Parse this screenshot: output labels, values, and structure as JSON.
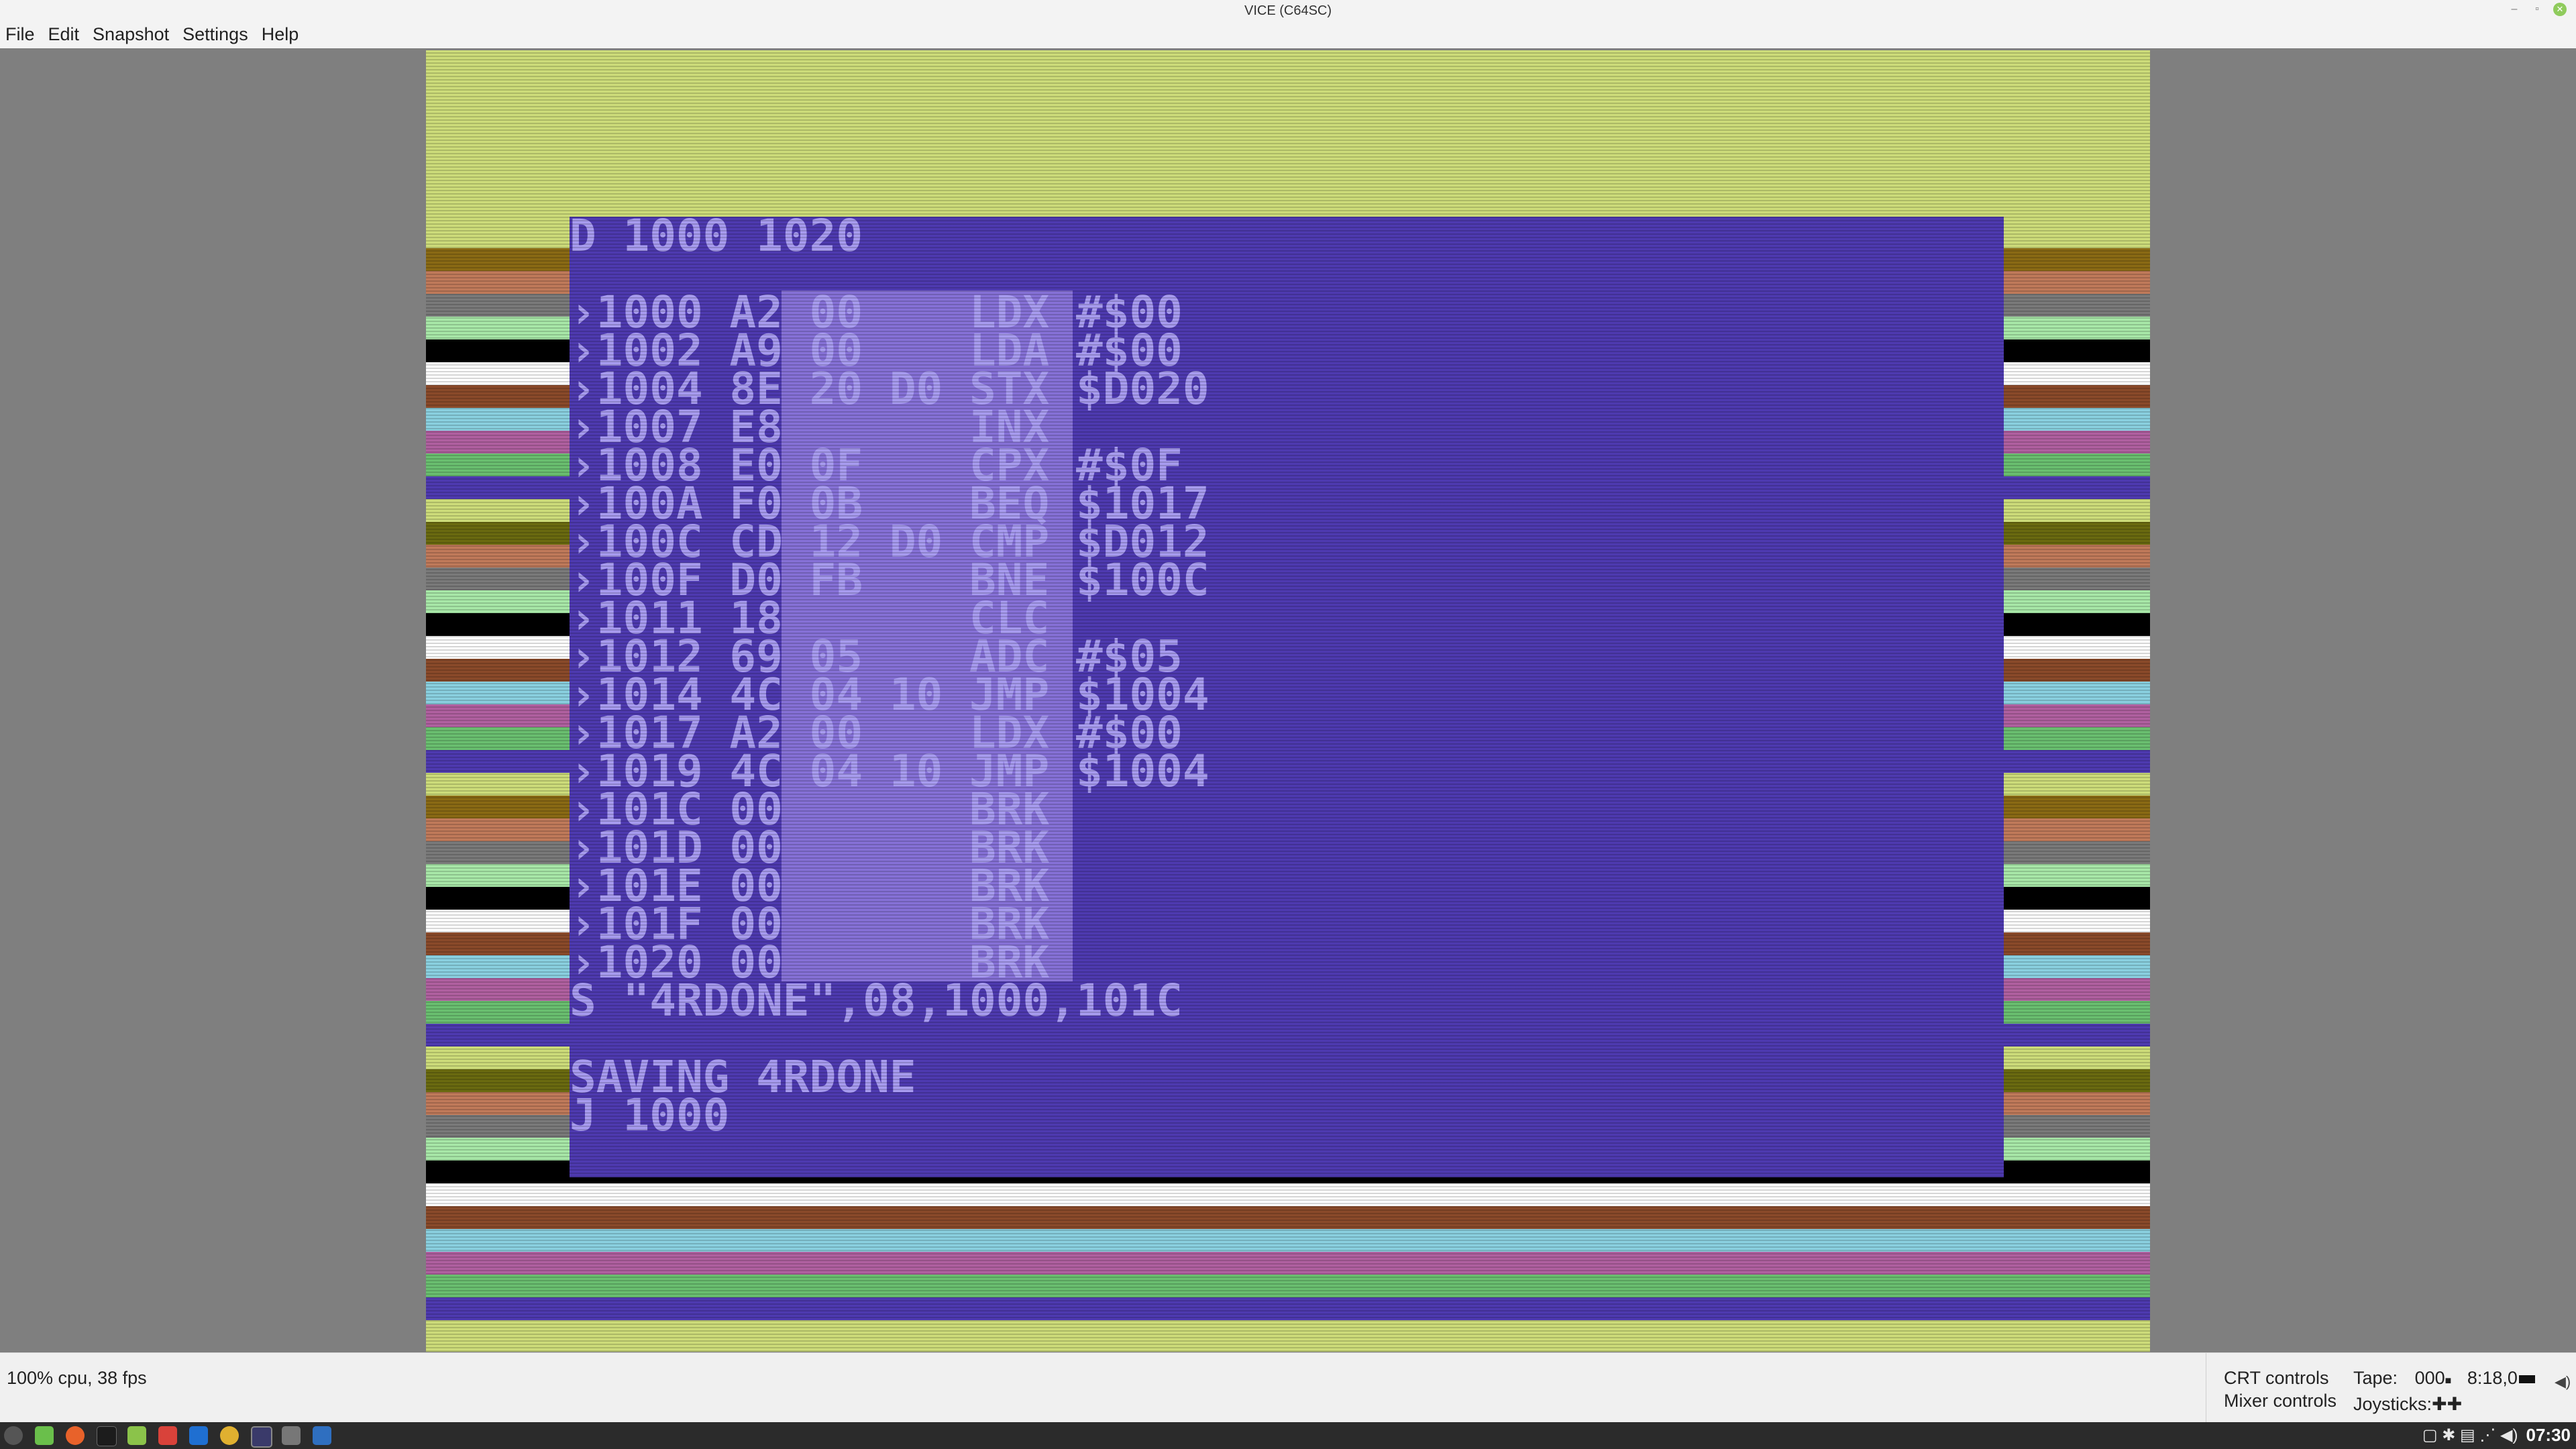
{
  "window": {
    "title": "VICE (C64SC)"
  },
  "menu": {
    "items": [
      "File",
      "Edit",
      "Snapshot",
      "Settings",
      "Help"
    ]
  },
  "c64_screen": {
    "lines": [
      "D 1000 1020",
      "",
      "›1000 A2 00    LDX #$00",
      "›1002 A9 00    LDA #$00",
      "›1004 8E 20 D0 STX $D020",
      "›1007 E8       INX",
      "›1008 E0 0F    CPX #$0F",
      "›100A F0 0B    BEQ $1017",
      "›100C CD 12 D0 CMP $D012",
      "›100F D0 FB    BNE $100C",
      "›1011 18       CLC",
      "›1012 69 05    ADC #$05",
      "›1014 4C 04 10 JMP $1004",
      "›1017 A2 00    LDX #$00",
      "›1019 4C 04 10 JMP $1004",
      "›101C 00       BRK",
      "›101D 00       BRK",
      "›101E 00       BRK",
      "›101F 00       BRK",
      "›1020 00       BRK",
      "S \"4RDONE\",08,1000,101C",
      "",
      "SAVING 4RDONE",
      "J 1000"
    ],
    "colors": {
      "background": "#4e3ab0",
      "text": "#a89cf0",
      "highlight": "#8d78dc",
      "border_top": "#cddc7a"
    }
  },
  "status": {
    "cpu": "100% cpu, 38 fps",
    "crt_controls": "CRT controls",
    "mixer_controls": "Mixer controls",
    "tape_label": "Tape:",
    "tape_counter": "000",
    "tape_position": "8:18,0",
    "joysticks_label": "Joysticks:"
  },
  "taskbar": {
    "clock": "07:30"
  }
}
